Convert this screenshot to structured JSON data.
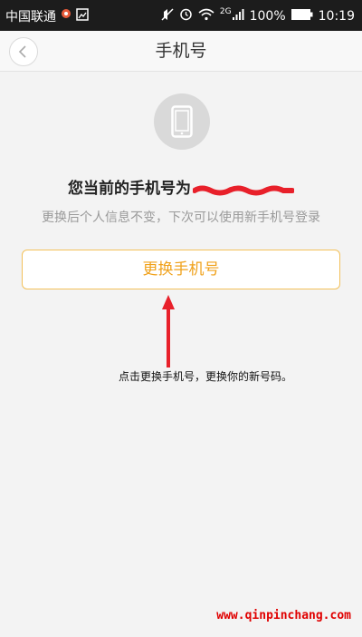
{
  "status_bar": {
    "carrier": "中国联通",
    "network": "2G",
    "battery": "100%",
    "time": "10:19"
  },
  "navbar": {
    "title": "手机号",
    "back_icon": "chevron-left-icon"
  },
  "main": {
    "phone_icon": "smartphone-icon",
    "current_prefix": "您当前的手机号为",
    "hint": "更换后个人信息不变，下次可以使用新手机号登录",
    "change_button": "更换手机号"
  },
  "annotation": {
    "text": "点击更换手机号，更换你的新号码。"
  },
  "watermark": "www.qinpinchang.com",
  "colors": {
    "accent": "#f0a21c",
    "button_border": "#f3c15a",
    "annotation_red": "#e8202a"
  }
}
